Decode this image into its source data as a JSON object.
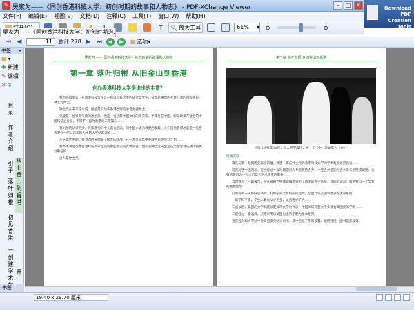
{
  "window": {
    "title": "吴家为——《同创香港科技大学：初创时期的故事和人物志》 - PDF-XChange Viewer"
  },
  "promo": {
    "line1": "Download PDF",
    "line2": "Creation Tools"
  },
  "menu": [
    "文件(F)",
    "编辑(E)",
    "视图(V)",
    "文档(D)",
    "注释(C)",
    "工具(T)",
    "窗口(W)",
    "帮助(H)"
  ],
  "toolbar": {
    "open_label": "打开(O)...",
    "zoom_tool_label": "放大工具",
    "zoom_value": "61%"
  },
  "tab": {
    "label": "吴家为——《同创香港科技大学：初创时期的..."
  },
  "nav": {
    "current_page": "11",
    "total_pages": "总计 278",
    "options_label": "选项"
  },
  "sidebar": {
    "header": "书签",
    "items": [
      "新建",
      "编辑"
    ],
    "bookmarks": [
      "目录",
      "作者介绍",
      "引子",
      "落叶归根",
      "从旧金山到香港",
      "初见香港",
      "一创建学术框架",
      "开"
    ],
    "bottom_tab": "书签"
  },
  "page_left": {
    "header": "吴家为  ——  同创香港科技大学：初创时期的故事和人物志",
    "chapter": "第一章   落叶归根   从旧金山到香港",
    "section": "创办香港科技大学是谁出的主意？",
    "paragraphs": [
      "我首先得承认，在香港科技大学以一所以科技为主的研究型大学，究竟是谁出的主意？我的回答总是：钟士元博士。",
      "钟士元从未不这么说。他总是归功于香港当时的总督尤德爵士。",
      "无疑是一位很有气质的政治家，也是一位了解中国文化的外交家。半年任在中国，眼见改革开放后的中国科技之发展，不得不一再为香港的未来操心……",
      "我对他的认识不多，只知道他们中文造诣甚高，对中国人极为尊重的爱戴。人们说他香港总督是一位在香港办一所以理工科为主的大学的起源者……",
      "八十年代中期，香港的时局面临了极大的挑战，在一九八四年中英联合声明签订之后……",
      "我不太清楚创办香港科技大学之前的那些会议的具体内容，但知道钟士元先生是在尤德总督任期内被委以重任的……",
      "这人是钟士元。"
    ]
  },
  "page_right": {
    "header": "第一章   落叶归根   从旧金山到香港",
    "caption": "图1    1991年10月，科大开学典礼，钟士元（中）与吴家为（左）",
    "section": "招兵买马",
    "paragraphs": [
      "请先与我一起把历史再往前推，我曾一再与钟士元为香港科技大学的学术框架进行商议……",
      "可见对于中国内地，曾经有过一段时期面对大专院校的合并，一些合并是因为五十年代的院校调整，也有的是因为一九八〇年代学术研究的需要……",
      "当时我写了一篇报告，在这篇报告中我详细地分析了香港的大学系统，我的结论是：科大要以一个全新的面貌出现……",
      "打听得有一天好好谈谈时，打探研究大专院校的起源，全面比较美国和欧洲的大学系统……",
      "一般学科不多，学生人数也从少到多，以后逐步扩大……",
      "二战以后，美国的大学制度以芝加哥大学为代表，中国的研究型大学多数为英国式的学制……",
      "三是经过一番选择，决定采用以美国为主的学制为基本框架。",
      "我曾经为科大写过一份三百多页的计划书，其中包括了学科设置、招聘教授、图书馆建设等。"
    ]
  },
  "status": {
    "dimensions": "19.40 x 29.70 厘米"
  },
  "colors": {
    "chapter_green": "#1f8a3a",
    "frame_blue": "#9fc0e8"
  }
}
